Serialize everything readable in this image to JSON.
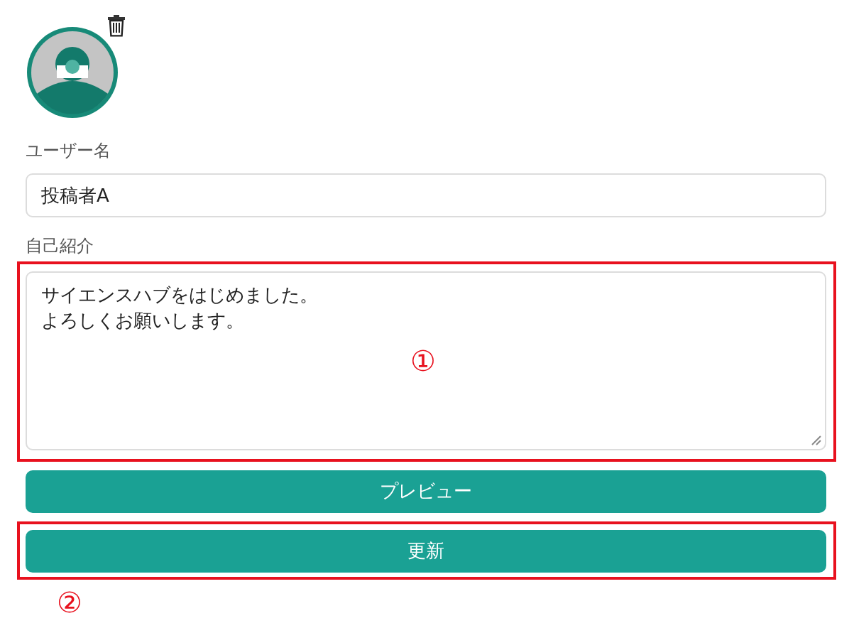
{
  "username": {
    "label": "ユーザー名",
    "value": "投稿者A"
  },
  "bio": {
    "label": "自己紹介",
    "lines": [
      "サイエンスハブをはじめました。",
      "よろしくお願いします。"
    ],
    "callout": "①"
  },
  "preview_button": {
    "label": "プレビュー"
  },
  "update_button": {
    "label": "更新",
    "callout": "②"
  }
}
